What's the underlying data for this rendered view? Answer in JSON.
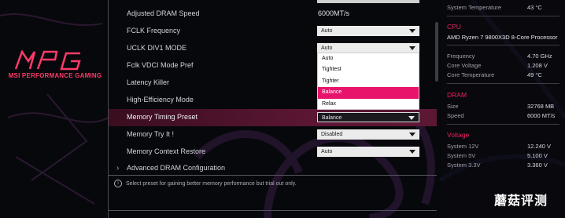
{
  "brand": {
    "logo_text": "MPG",
    "subtitle": "MSI PERFORMANCE GAMING"
  },
  "settings": [
    {
      "label": "Adjusted DRAM Speed",
      "value": "6000MT/s",
      "kind": "text"
    },
    {
      "label": "FCLK Frequency",
      "value": "Auto",
      "kind": "select"
    },
    {
      "label": "UCLK DIV1 MODE",
      "value": "Auto",
      "kind": "select"
    },
    {
      "label": "Fclk VDCI Mode Pref",
      "value": "",
      "kind": "none"
    },
    {
      "label": "Latency Killer",
      "value": "",
      "kind": "none"
    },
    {
      "label": "High-Efficiency Mode",
      "value": "",
      "kind": "none"
    },
    {
      "label": "Memory Timing Preset",
      "value": "Balance",
      "kind": "select",
      "selected": true
    },
    {
      "label": "Memory Try It !",
      "value": "Disabled",
      "kind": "select"
    },
    {
      "label": "Memory Context Restore",
      "value": "Auto",
      "kind": "select"
    },
    {
      "label": "Advanced DRAM Configuration",
      "value": "",
      "kind": "submenu"
    }
  ],
  "dropdown": {
    "options": [
      "Auto",
      "Tightest",
      "Tighter",
      "Balance",
      "Relax"
    ],
    "active": "Balance"
  },
  "help_text": "Select preset for gaining better memory performance but trial out only.",
  "info_panel": {
    "system_temperature_label": "System Temperature",
    "system_temperature_value": "43 °C",
    "cpu_heading": "CPU",
    "cpu_name": "AMD Ryzen 7 9800X3D 8-Core Processor",
    "cpu_rows": [
      {
        "label": "Frequency",
        "value": "4.70 GHz"
      },
      {
        "label": "Core Voltage",
        "value": "1.208 V"
      },
      {
        "label": "Core Temperature",
        "value": "49 °C"
      }
    ],
    "dram_heading": "DRAM",
    "dram_rows": [
      {
        "label": "Size",
        "value": "32768 MB"
      },
      {
        "label": "Speed",
        "value": "6000 MT/s"
      }
    ],
    "voltage_heading": "Voltage",
    "voltage_rows": [
      {
        "label": "System 12V",
        "value": "12.240 V"
      },
      {
        "label": "System 5V",
        "value": "5.100 V"
      },
      {
        "label": "System 3.3V",
        "value": "3.360 V"
      }
    ]
  },
  "watermark": "蘑菇评测",
  "colors": {
    "accent": "#e8146c",
    "selected_row": "#5a1634",
    "background": "#07080c"
  }
}
